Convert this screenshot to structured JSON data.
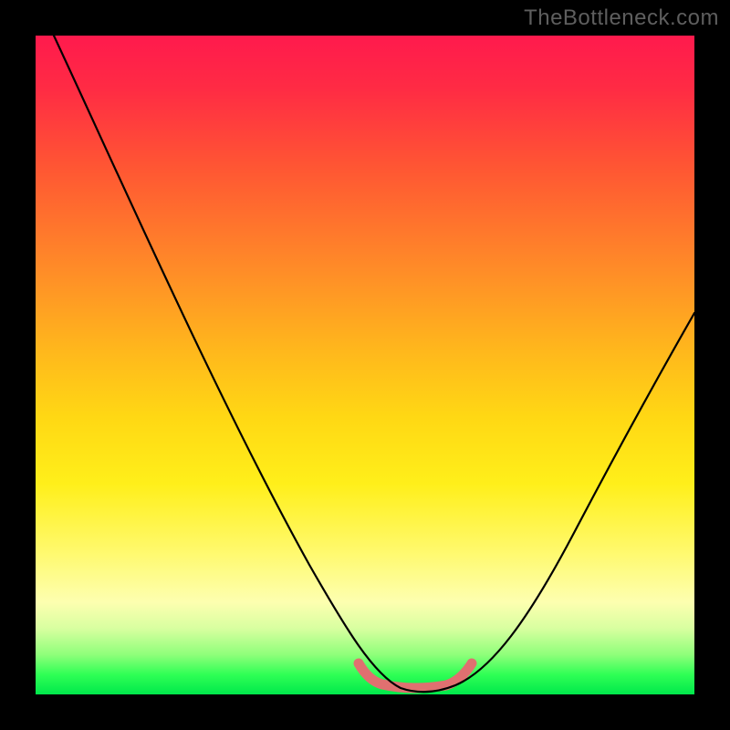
{
  "watermark": "TheBottleneck.com",
  "chart_data": {
    "type": "line",
    "title": "",
    "xlabel": "",
    "ylabel": "",
    "xlim": [
      0,
      100
    ],
    "ylim": [
      0,
      100
    ],
    "series": [
      {
        "name": "bottleneck-curve",
        "x": [
          3,
          10,
          20,
          30,
          40,
          47,
          52,
          55,
          58,
          62,
          66,
          70,
          80,
          90,
          100
        ],
        "y": [
          100,
          85,
          63,
          42,
          22,
          8,
          2,
          0,
          0,
          0,
          2,
          6,
          22,
          40,
          58
        ]
      }
    ],
    "highlight": {
      "name": "optimal-range",
      "x": [
        49,
        52,
        55,
        58,
        61,
        64,
        67
      ],
      "y": [
        4,
        1,
        0,
        0,
        0,
        1,
        4
      ],
      "color": "#e07070"
    },
    "background_gradient": {
      "top": "#ff1a4d",
      "mid_upper": "#ff8a28",
      "mid": "#ffef1a",
      "mid_lower": "#d8ffa0",
      "bottom": "#00e84b"
    }
  }
}
